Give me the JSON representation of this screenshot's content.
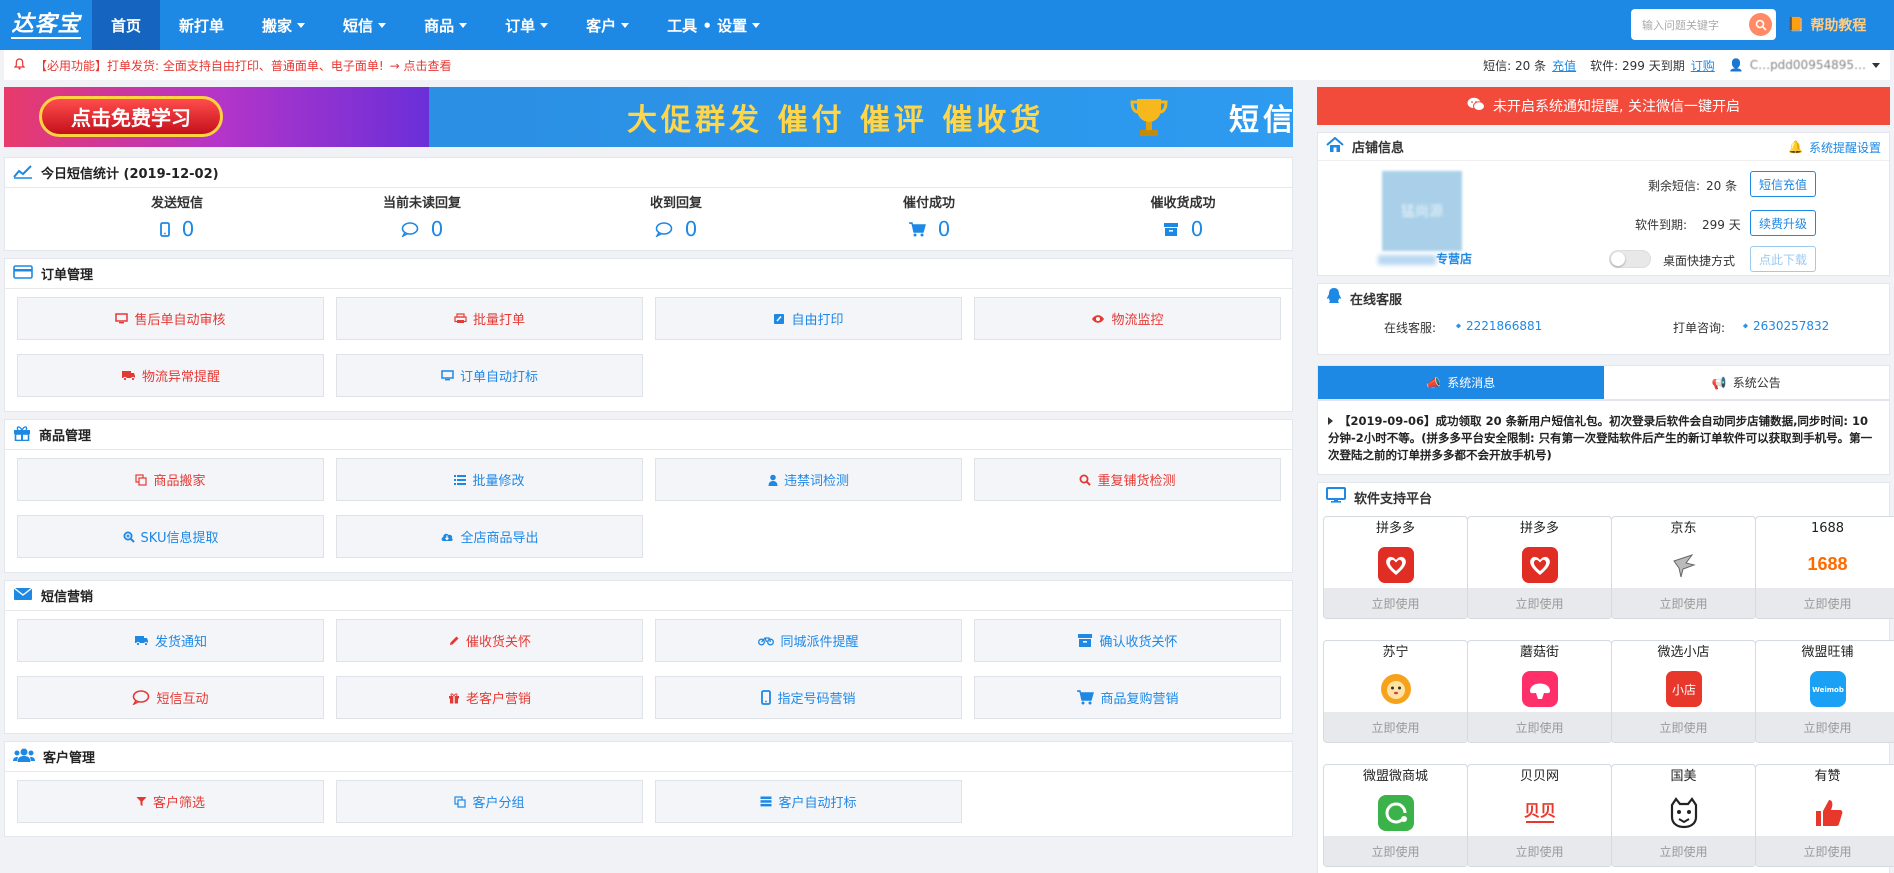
{
  "app": {
    "logo": "达客宝"
  },
  "nav": [
    {
      "label": "首页",
      "active": true,
      "dropdown": false
    },
    {
      "label": "新打单",
      "active": false,
      "dropdown": false
    },
    {
      "label": "搬家",
      "active": false,
      "dropdown": true
    },
    {
      "label": "短信",
      "active": false,
      "dropdown": true
    },
    {
      "label": "商品",
      "active": false,
      "dropdown": true
    },
    {
      "label": "订单",
      "active": false,
      "dropdown": true
    },
    {
      "label": "客户",
      "active": false,
      "dropdown": true
    },
    {
      "label": "工具 • 设置",
      "active": false,
      "dropdown": true
    }
  ],
  "search": {
    "placeholder": "输入问题关键字"
  },
  "help": {
    "label": "帮助教程"
  },
  "notice": {
    "text": "【必用功能】打单发货: 全面支持自由打印、普通面单、电子面单!",
    "link": "→ 点击查看"
  },
  "account": {
    "sms": "短信: 20 条",
    "recharge": "充值",
    "software": "软件: 299 天到期",
    "subscribe": "订购",
    "user": "C…pdd00954895…"
  },
  "banner": {
    "pill": "点击免费学习",
    "slogan": "大促群发  催付  催评  催收货",
    "tail": "短信"
  },
  "stats": {
    "title": "今日短信统计 (2019-12-02)",
    "items": [
      {
        "label": "发送短信",
        "value": "0",
        "icon": "mobile-icon"
      },
      {
        "label": "当前未读回复",
        "value": "0",
        "icon": "comment-icon"
      },
      {
        "label": "收到回复",
        "value": "0",
        "icon": "comment-icon"
      },
      {
        "label": "催付成功",
        "value": "0",
        "icon": "cart-icon"
      },
      {
        "label": "催收货成功",
        "value": "0",
        "icon": "archive-icon"
      }
    ]
  },
  "sections": {
    "orders": {
      "title": "订单管理",
      "buttons": [
        {
          "label": "售后单自动审核",
          "color": "red",
          "icon": "monitor-icon"
        },
        {
          "label": "批量打单",
          "color": "red",
          "icon": "print-icon"
        },
        {
          "label": "自由打印",
          "color": "blue",
          "icon": "edit-icon"
        },
        {
          "label": "物流监控",
          "color": "red",
          "icon": "eye-icon"
        },
        {
          "label": "物流异常提醒",
          "color": "red",
          "icon": "truck-icon"
        },
        {
          "label": "订单自动打标",
          "color": "blue",
          "icon": "monitor-icon"
        }
      ]
    },
    "goods": {
      "title": "商品管理",
      "buttons": [
        {
          "label": "商品搬家",
          "color": "red",
          "icon": "copy-icon"
        },
        {
          "label": "批量修改",
          "color": "blue",
          "icon": "list-icon"
        },
        {
          "label": "违禁词检测",
          "color": "blue",
          "icon": "user-icon"
        },
        {
          "label": "重复铺货检测",
          "color": "red",
          "icon": "search-icon"
        },
        {
          "label": "SKU信息提取",
          "color": "blue",
          "icon": "zoom-icon"
        },
        {
          "label": "全店商品导出",
          "color": "blue",
          "icon": "cloud-download-icon"
        }
      ]
    },
    "sms": {
      "title": "短信营销",
      "buttons": [
        {
          "label": "发货通知",
          "color": "blue",
          "icon": "truck-icon"
        },
        {
          "label": "催收货关怀",
          "color": "red",
          "icon": "pencil-icon"
        },
        {
          "label": "同城派件提醒",
          "color": "blue",
          "icon": "bike-icon"
        },
        {
          "label": "确认收货关怀",
          "color": "blue",
          "icon": "archive-icon"
        },
        {
          "label": "短信互动",
          "color": "red",
          "icon": "comment-icon"
        },
        {
          "label": "老客户营销",
          "color": "red",
          "icon": "gift-icon"
        },
        {
          "label": "指定号码营销",
          "color": "blue",
          "icon": "mobile-icon"
        },
        {
          "label": "商品复购营销",
          "color": "blue",
          "icon": "cart-icon"
        }
      ]
    },
    "customers": {
      "title": "客户管理",
      "buttons": [
        {
          "label": "客户筛选",
          "color": "red",
          "icon": "filter-icon"
        },
        {
          "label": "客户分组",
          "color": "blue",
          "icon": "copy-icon"
        },
        {
          "label": "客户自动打标",
          "color": "blue",
          "icon": "server-icon"
        }
      ]
    }
  },
  "wechat": {
    "text": "未开启系统通知提醒, 关注微信一键开启"
  },
  "shop": {
    "title": "店铺信息",
    "settings": "系统提醒设置",
    "avatar_text": "猛尚源",
    "name": "专营店",
    "sms_left_label": "剩余短信:",
    "sms_left": "20 条",
    "sms_btn": "短信充值",
    "expire_label": "软件到期:",
    "expire": "299 天",
    "expire_btn": "续费升级",
    "desktop_label": "桌面快捷方式",
    "desktop_btn": "点此下载"
  },
  "service": {
    "title": "在线客服",
    "online_label": "在线客服:",
    "online_qq": "2221866881",
    "print_label": "打单咨询:",
    "print_qq": "2630257832"
  },
  "msg_tabs": [
    {
      "label": "系统消息",
      "active": true
    },
    {
      "label": "系统公告",
      "active": false
    }
  ],
  "message": "【2019-09-06】成功领取 20 条新用户短信礼包。初次登录后软件会自动同步店铺数据,同步时间: 10分钟-2小时不等。(拼多多平台安全限制: 只有第一次登陆软件后产生的新订单软件可以获取到手机号。第一次登陆之前的订单拼多多都不会开放手机号)",
  "platforms_title": "软件支持平台",
  "platforms": [
    {
      "name": "拼多多",
      "use": "立即使用",
      "icon": "pinduoduo-icon",
      "color": "#e02e24"
    },
    {
      "name": "拼多多",
      "use": "立即使用",
      "icon": "pinduoduo-icon",
      "color": "#e02e24"
    },
    {
      "name": "京东",
      "use": "立即使用",
      "icon": "jd-icon",
      "color": "#999999"
    },
    {
      "name": "1688",
      "use": "立即使用",
      "icon": "1688-icon",
      "color": "#ff6a00"
    },
    {
      "name": "苏宁",
      "use": "立即使用",
      "icon": "suning-icon",
      "color": "#f7a21b"
    },
    {
      "name": "蘑菇街",
      "use": "立即使用",
      "icon": "mogujie-icon",
      "color": "#ff2f6a"
    },
    {
      "name": "微选小店",
      "use": "立即使用",
      "icon": "weixuan-icon",
      "color": "#e8382c"
    },
    {
      "name": "微盟旺铺",
      "use": "立即使用",
      "icon": "weimob-icon",
      "color": "#1aa0f5"
    },
    {
      "name": "微盟微商城",
      "use": "立即使用",
      "icon": "weimob-mall-icon",
      "color": "#3cb34a"
    },
    {
      "name": "贝贝网",
      "use": "立即使用",
      "icon": "beibei-icon",
      "color": "#e8382c"
    },
    {
      "name": "国美",
      "use": "立即使用",
      "icon": "gome-icon",
      "color": "#222222"
    },
    {
      "name": "有赞",
      "use": "立即使用",
      "icon": "youzan-icon",
      "color": "#e8382c"
    }
  ],
  "platform_icon_text": {
    "weixuan": "小店",
    "weimob": "Weimob",
    "beibei": "贝贝",
    "p1688": "1688"
  }
}
